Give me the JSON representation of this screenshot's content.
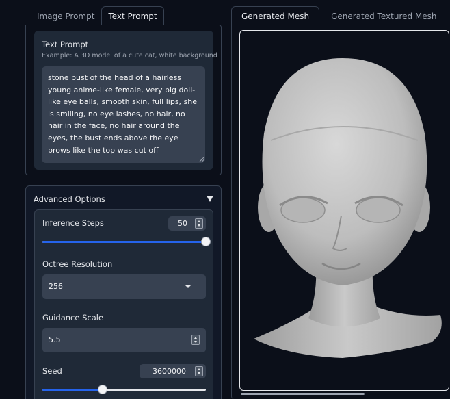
{
  "left_tabs": [
    {
      "label": "Image Prompt",
      "active": false
    },
    {
      "label": "Text Prompt",
      "active": true
    }
  ],
  "right_tabs": [
    {
      "label": "Generated Mesh",
      "active": true
    },
    {
      "label": "Generated Textured Mesh",
      "active": false
    }
  ],
  "text_prompt": {
    "label": "Text Prompt",
    "info": "Example: A 3D model of a cute cat, white background",
    "value": "stone bust of the head of a hairless young anime-like female, very big doll-like eye balls, smooth skin, full lips, she is smiling, no eye lashes, no hair, no hair in the face, no hair around the eyes, the bust ends above the eye brows like the top was cut off"
  },
  "advanced": {
    "title": "Advanced Options",
    "inference_steps": {
      "label": "Inference Steps",
      "value": "50",
      "fraction": 1.0
    },
    "octree_resolution": {
      "label": "Octree Resolution",
      "value": "256"
    },
    "guidance_scale": {
      "label": "Guidance Scale",
      "value": "5.5"
    },
    "seed": {
      "label": "Seed",
      "value": "3600000",
      "fraction": 0.37
    }
  },
  "colors": {
    "accent": "#2563eb",
    "background": "#0b0f19",
    "panel": "#1f2937"
  }
}
